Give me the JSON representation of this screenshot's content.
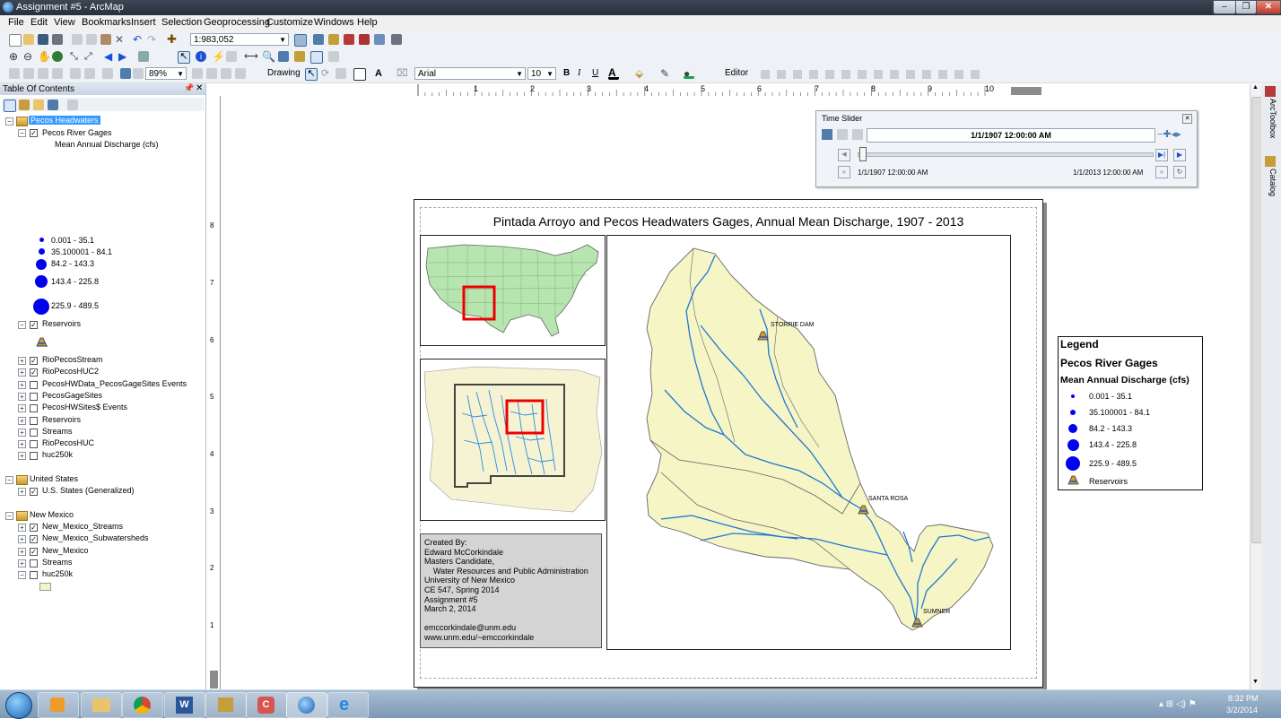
{
  "window": {
    "title": "Assignment #5 - ArcMap"
  },
  "menu": [
    "File",
    "Edit",
    "View",
    "Bookmarks",
    "Insert",
    "Selection",
    "Geoprocessing",
    "Customize",
    "Windows",
    "Help"
  ],
  "toolbar": {
    "scale": "1:983,052",
    "zoom": "89%",
    "drawing_label": "Drawing",
    "font": "Arial",
    "font_size": "10",
    "bold": "B",
    "italic": "I",
    "underline": "U",
    "editor_label": "Editor"
  },
  "toc": {
    "title": "Table Of Contents",
    "groups": [
      {
        "name": "Pecos Headwaters",
        "layers": [
          {
            "name": "Pecos River Gages",
            "checked": true
          },
          {
            "name": "Reservoirs",
            "checked": true
          },
          {
            "name": "RioPecosStream",
            "checked": true
          },
          {
            "name": "RioPecosHUC2",
            "checked": true
          },
          {
            "name": "PecosHWData_PecosGageSites Events",
            "checked": false
          },
          {
            "name": "PecosGageSites",
            "checked": false
          },
          {
            "name": "PecosHWSites$ Events",
            "checked": false
          },
          {
            "name": "Reservoirs",
            "checked": false
          },
          {
            "name": "Streams",
            "checked": false
          },
          {
            "name": "RioPecosHUC",
            "checked": false
          },
          {
            "name": "huc250k",
            "checked": false
          }
        ]
      },
      {
        "name": "United States",
        "layers": [
          {
            "name": "U.S. States (Generalized)",
            "checked": true
          }
        ]
      },
      {
        "name": "New Mexico",
        "layers": [
          {
            "name": "New_Mexico_Streams",
            "checked": true
          },
          {
            "name": "New_Mexico_Subwatersheds",
            "checked": true
          },
          {
            "name": "New_Mexico",
            "checked": true
          },
          {
            "name": "Streams",
            "checked": false
          },
          {
            "name": "huc250k",
            "checked": false
          }
        ]
      }
    ],
    "field_label": "Mean Annual Discharge (cfs)",
    "classes": [
      "0.001 - 35.1",
      "35.100001 - 84.1",
      "84.2 - 143.3",
      "143.4 - 225.8",
      "225.9 - 489.5"
    ]
  },
  "time_slider": {
    "title": "Time Slider",
    "current": "1/1/1907 12:00:00 AM",
    "start": "1/1/1907 12:00:00 AM",
    "end": "1/1/2013 12:00:00 AM"
  },
  "layout": {
    "title": "Pintada Arroyo and Pecos Headwaters Gages, Annual Mean Discharge, 1907 - 2013",
    "credits": [
      "Created By:",
      "Edward McCorkindale",
      "Masters Candidate,",
      "    Water Resources and Public Administration",
      "University of New Mexico",
      "CE 547, Spring 2014",
      "Assignment #5",
      "March 2, 2014",
      "",
      "emccorkindale@unm.edu",
      "www.unm.edu/~emccorkindale"
    ],
    "legend": {
      "title": "Legend",
      "layer": "Pecos River Gages",
      "field": "Mean Annual Discharge (cfs)",
      "reservoirs": "Reservoirs"
    },
    "places": [
      "STORRIE DAM",
      "SANTA ROSA",
      "SUMNER"
    ]
  },
  "ruler_numbers": [
    "1",
    "2",
    "3",
    "4",
    "5",
    "6",
    "7",
    "8",
    "9",
    "10"
  ],
  "ruler_left_numbers": [
    "8",
    "7",
    "6",
    "5",
    "4",
    "3",
    "2",
    "1"
  ],
  "side_tabs": [
    "ArcToolbox",
    "Catalog"
  ],
  "clock": {
    "time": "8:32 PM",
    "date": "3/2/2014"
  }
}
